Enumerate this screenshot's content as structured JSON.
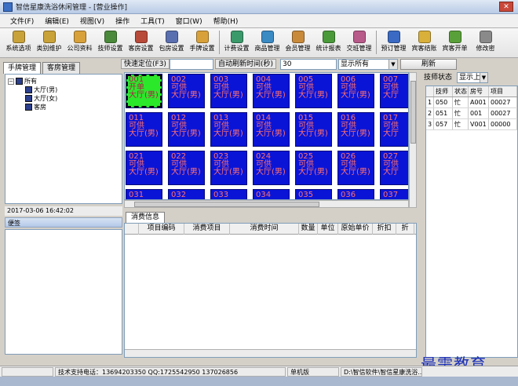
{
  "window": {
    "title": "智信星康洗浴休闲管理 - [营业操作]",
    "close_label": "✕"
  },
  "menu": [
    "文件(F)",
    "编辑(E)",
    "视图(V)",
    "操作",
    "工具(T)",
    "窗口(W)",
    "帮助(H)"
  ],
  "toolbar": [
    {
      "label": "系统选项",
      "icon": "settings-icon",
      "color": "#c9a23a"
    },
    {
      "label": "类别维护",
      "icon": "category-icon",
      "color": "#c9a23a"
    },
    {
      "label": "公司资料",
      "icon": "company-icon",
      "color": "#d9a13a"
    },
    {
      "label": "技师设置",
      "icon": "technician-icon",
      "color": "#4a8a3a"
    },
    {
      "label": "客房设置",
      "icon": "guestroom-icon",
      "color": "#b84a3a"
    },
    {
      "label": "包房设置",
      "icon": "privateroom-icon",
      "color": "#5a6fb0"
    },
    {
      "label": "手牌设置",
      "icon": "wristband-icon",
      "color": "#d9a13a"
    },
    {
      "label": "计费设置",
      "icon": "billing-icon",
      "color": "#3a9a6a"
    },
    {
      "label": "商品管理",
      "icon": "goods-icon",
      "color": "#3a8ac4"
    },
    {
      "label": "会员管理",
      "icon": "member-icon",
      "color": "#c98a3a"
    },
    {
      "label": "统计报表",
      "icon": "report-icon",
      "color": "#4a9a3a"
    },
    {
      "label": "交班管理",
      "icon": "shift-icon",
      "color": "#b85a8a"
    },
    {
      "label": "预订管理",
      "icon": "booking-icon",
      "color": "#3a6ac4"
    },
    {
      "label": "宾客结账",
      "icon": "checkout-icon",
      "color": "#d9b03a"
    },
    {
      "label": "宾客开单",
      "icon": "openbill-icon",
      "color": "#5aa03a"
    },
    {
      "label": "修改密",
      "icon": "password-icon",
      "color": "#8a8a8a"
    }
  ],
  "left_tabs": [
    "手牌管理",
    "客房管理"
  ],
  "tree": {
    "root": "所有",
    "children": [
      "大厅(男)",
      "大厅(女)",
      "客房"
    ]
  },
  "clock": "2017-03-06  16:42:02",
  "notes_title": "便签",
  "controls": {
    "quick_locate_label": "快速定位(F3)",
    "auto_refresh_label": "自动刷新时间(秒)",
    "auto_refresh_value": "30",
    "filter_value": "显示所有",
    "refresh_button": "刷新"
  },
  "rooms": [
    {
      "num": "001",
      "status": "开单",
      "type": "大厅(男)",
      "active": true
    },
    {
      "num": "002",
      "status": "可供",
      "type": "大厅(男)"
    },
    {
      "num": "003",
      "status": "可供",
      "type": "大厅(男)"
    },
    {
      "num": "004",
      "status": "可供",
      "type": "大厅(男)"
    },
    {
      "num": "005",
      "status": "可供",
      "type": "大厅(男)"
    },
    {
      "num": "006",
      "status": "可供",
      "type": "大厅(男)"
    },
    {
      "num": "007",
      "status": "可供",
      "type": "大厅"
    },
    {
      "num": "011",
      "status": "可供",
      "type": "大厅(男)"
    },
    {
      "num": "012",
      "status": "可供",
      "type": "大厅(男)"
    },
    {
      "num": "013",
      "status": "可供",
      "type": "大厅(男)"
    },
    {
      "num": "014",
      "status": "可供",
      "type": "大厅(男)"
    },
    {
      "num": "015",
      "status": "可供",
      "type": "大厅(男)"
    },
    {
      "num": "016",
      "status": "可供",
      "type": "大厅(男)"
    },
    {
      "num": "017",
      "status": "可供",
      "type": "大厅"
    },
    {
      "num": "021",
      "status": "可供",
      "type": "大厅(男)"
    },
    {
      "num": "022",
      "status": "可供",
      "type": "大厅(男)"
    },
    {
      "num": "023",
      "status": "可供",
      "type": "大厅(男)"
    },
    {
      "num": "024",
      "status": "可供",
      "type": "大厅(男)"
    },
    {
      "num": "025",
      "status": "可供",
      "type": "大厅(男)"
    },
    {
      "num": "026",
      "status": "可供",
      "type": "大厅(男)"
    },
    {
      "num": "027",
      "status": "可供",
      "type": "大厅"
    },
    {
      "num": "031",
      "status": "",
      "type": ""
    },
    {
      "num": "032",
      "status": "",
      "type": ""
    },
    {
      "num": "033",
      "status": "",
      "type": ""
    },
    {
      "num": "034",
      "status": "",
      "type": ""
    },
    {
      "num": "035",
      "status": "",
      "type": ""
    },
    {
      "num": "036",
      "status": "",
      "type": ""
    },
    {
      "num": "037",
      "status": "",
      "type": ""
    }
  ],
  "consumption": {
    "tab": "消费信息",
    "columns": [
      "项目编码",
      "消费项目",
      "消费时间",
      "数量",
      "单位",
      "原始单价",
      "折扣",
      "折"
    ]
  },
  "technician": {
    "status_label": "技师状态",
    "status_value": "显示上",
    "columns": [
      "",
      "技师",
      "状态",
      "房号",
      "项目"
    ],
    "rows": [
      [
        "1",
        "050",
        "忙",
        "A001",
        "00027"
      ],
      [
        "2",
        "051",
        "忙",
        "001",
        "00027"
      ],
      [
        "3",
        "057",
        "忙",
        "V001",
        "00000"
      ]
    ]
  },
  "status_bar": {
    "support": "技术支持电话：13694203350 QQ:1725542950 137026856",
    "edition": "单机版",
    "path": "D:\\智信软件\\智信星康洗浴..."
  },
  "watermark": "最需教育"
}
